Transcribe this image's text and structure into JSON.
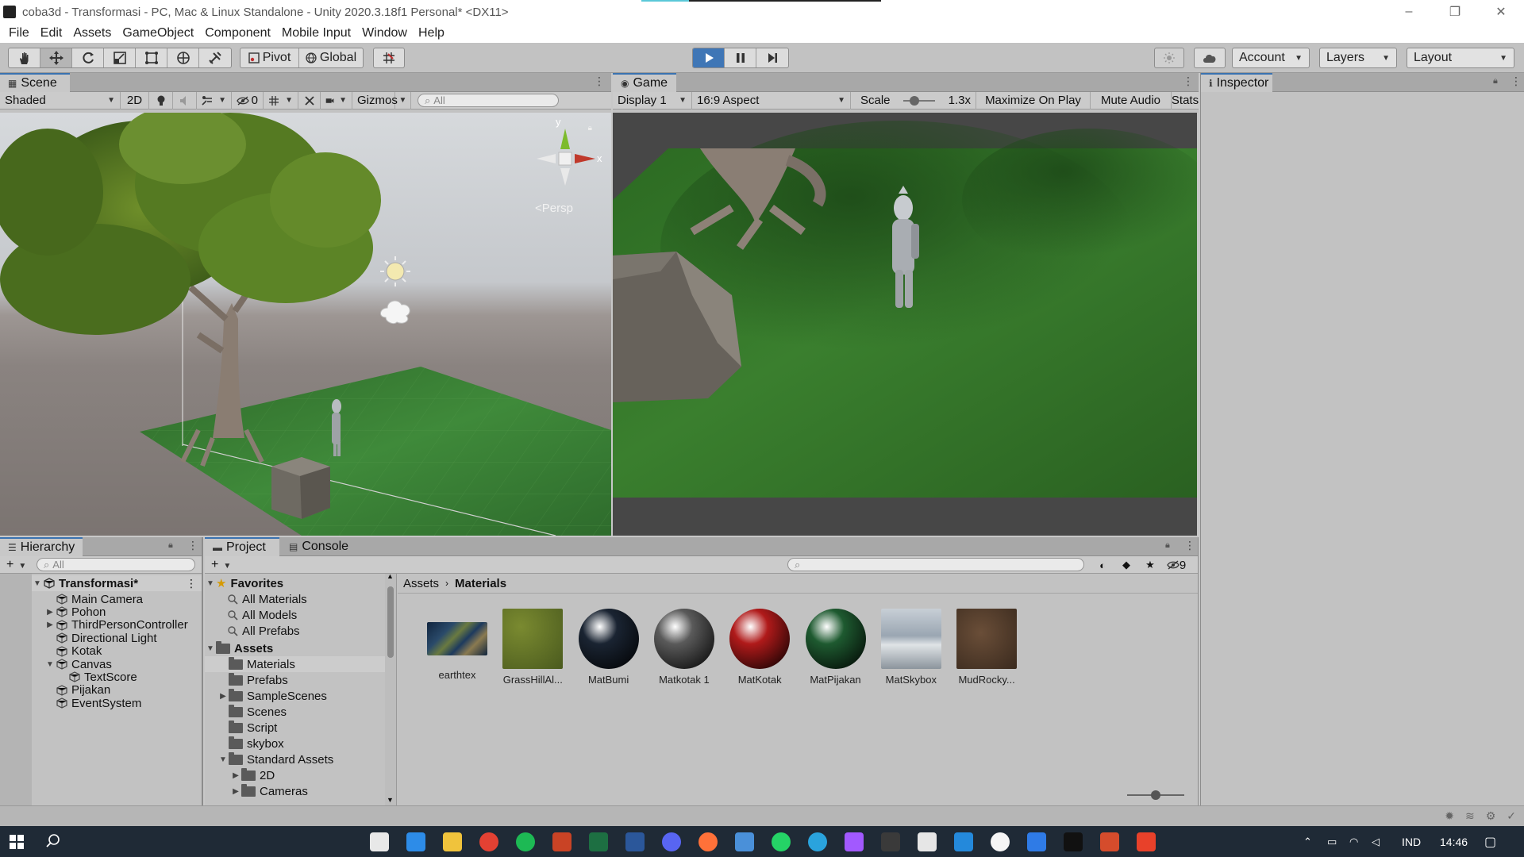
{
  "window": {
    "title": "coba3d - Transformasi - PC, Mac & Linux Standalone - Unity 2020.3.18f1 Personal* <DX11>",
    "controls": [
      "–",
      "❐",
      "✕"
    ]
  },
  "menu": [
    "File",
    "Edit",
    "Assets",
    "GameObject",
    "Component",
    "Mobile Input",
    "Window",
    "Help"
  ],
  "toolbar": {
    "pivot_label": "Pivot",
    "global_label": "Global",
    "account_label": "Account",
    "layers_label": "Layers",
    "layout_label": "Layout",
    "play_state": "playing"
  },
  "scene": {
    "tab_label": "Scene",
    "shading_mode": "Shaded",
    "mode_2d": "2D",
    "hidden_count": "0",
    "gizmos_label": "Gizmos",
    "search_placeholder": "All",
    "persp_label": "<Persp",
    "axis_y": "y",
    "axis_x": "x"
  },
  "game": {
    "tab_label": "Game",
    "display": "Display 1",
    "aspect": "16:9 Aspect",
    "scale_label": "Scale",
    "scale_value": "1.3x",
    "scale_level": 0.3,
    "maximize_label": "Maximize On Play",
    "mute_label": "Mute Audio",
    "stats_label": "Stats"
  },
  "inspector": {
    "tab_label": "Inspector"
  },
  "hierarchy": {
    "tab_label": "Hierarchy",
    "search_placeholder": "All",
    "scene_name": "Transformasi*",
    "items": [
      {
        "label": "Main Camera",
        "depth": 1,
        "expander": ""
      },
      {
        "label": "Pohon",
        "depth": 1,
        "expander": "collapsed"
      },
      {
        "label": "ThirdPersonController",
        "depth": 1,
        "expander": "collapsed"
      },
      {
        "label": "Directional Light",
        "depth": 1,
        "expander": ""
      },
      {
        "label": "Kotak",
        "depth": 1,
        "expander": ""
      },
      {
        "label": "Canvas",
        "depth": 1,
        "expander": "expanded"
      },
      {
        "label": "TextScore",
        "depth": 2,
        "expander": ""
      },
      {
        "label": "Pijakan",
        "depth": 1,
        "expander": ""
      },
      {
        "label": "EventSystem",
        "depth": 1,
        "expander": ""
      }
    ]
  },
  "project": {
    "tab_label": "Project",
    "console_tab_label": "Console",
    "hidden_packages_count": "9",
    "favorites_label": "Favorites",
    "favorites": [
      "All Materials",
      "All Models",
      "All Prefabs"
    ],
    "assets_label": "Assets",
    "folders": [
      {
        "label": "Materials",
        "depth": 1,
        "expander": "",
        "selected": true
      },
      {
        "label": "Prefabs",
        "depth": 1,
        "expander": "",
        "selected": false
      },
      {
        "label": "SampleScenes",
        "depth": 1,
        "expander": "collapsed",
        "selected": false
      },
      {
        "label": "Scenes",
        "depth": 1,
        "expander": "",
        "selected": false
      },
      {
        "label": "Script",
        "depth": 1,
        "expander": "",
        "selected": false
      },
      {
        "label": "skybox",
        "depth": 1,
        "expander": "",
        "selected": false
      },
      {
        "label": "Standard Assets",
        "depth": 1,
        "expander": "expanded",
        "selected": false
      },
      {
        "label": "2D",
        "depth": 2,
        "expander": "collapsed",
        "selected": false
      },
      {
        "label": "Cameras",
        "depth": 2,
        "expander": "collapsed",
        "selected": false
      }
    ],
    "breadcrumb": [
      "Assets",
      "Materials"
    ],
    "assets": [
      {
        "label": "earthtex",
        "kind": "texture"
      },
      {
        "label": "GrassHillAl...",
        "kind": "texture"
      },
      {
        "label": "MatBumi",
        "kind": "material",
        "color": "#1a2432"
      },
      {
        "label": "Matkotak 1",
        "kind": "material",
        "color": "#5a5a5a"
      },
      {
        "label": "MatKotak",
        "kind": "material",
        "color": "#b01a1a"
      },
      {
        "label": "MatPijakan",
        "kind": "material",
        "color": "#1e5a30"
      },
      {
        "label": "MatSkybox",
        "kind": "texture"
      },
      {
        "label": "MudRocky...",
        "kind": "texture"
      }
    ],
    "zoom_level": 0.5
  },
  "taskbar": {
    "language": "IND",
    "time": "14:46"
  },
  "colors": {
    "accent": "#3f76b6",
    "panel": "#c2c2c2"
  }
}
